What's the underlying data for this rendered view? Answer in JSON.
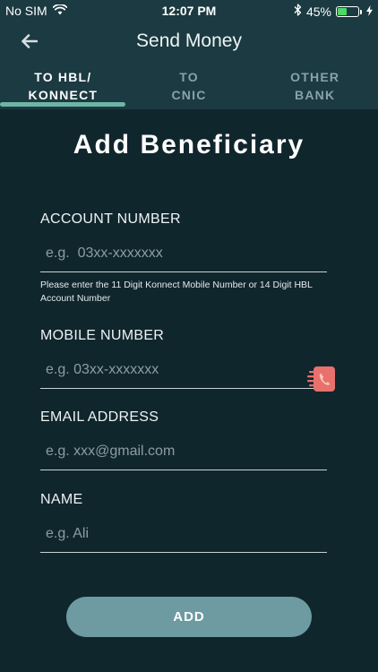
{
  "status_bar": {
    "carrier": "No SIM",
    "time": "12:07 PM",
    "battery": "45%",
    "battery_level": 0.45
  },
  "header": {
    "title": "Send Money"
  },
  "tabs": [
    {
      "label": "TO HBL/\nKONNECT",
      "active": true
    },
    {
      "label": "TO\nCNIC",
      "active": false
    },
    {
      "label": "OTHER\nBANK",
      "active": false
    }
  ],
  "page_title": "Add Beneficiary",
  "form": {
    "account_number": {
      "label": "ACCOUNT NUMBER",
      "placeholder": "e.g.  03xx-xxxxxxx",
      "value": "",
      "hint": "Please enter the 11 Digit Konnect Mobile Number or 14 Digit HBL Account Number"
    },
    "mobile_number": {
      "label": "MOBILE NUMBER",
      "placeholder": "e.g. 03xx-xxxxxxx",
      "value": ""
    },
    "email_address": {
      "label": "EMAIL ADDRESS",
      "placeholder": "e.g. xxx@gmail.com",
      "value": ""
    },
    "name": {
      "label": "NAME",
      "placeholder": "e.g. Ali",
      "value": ""
    }
  },
  "add_button_label": "ADD",
  "icons": {
    "wifi": "wifi-icon",
    "bluetooth": "bluetooth-icon",
    "battery": "battery-icon",
    "charging": "charging-icon",
    "back": "back-arrow-icon",
    "contacts": "contact-book-icon"
  },
  "colors": {
    "background": "#10262d",
    "header": "#1b3a41",
    "tab_indicator": "#6fb5a6",
    "button": "#6e9aa1",
    "contact_icon": "#e8706d",
    "battery_fill": "#4cd964"
  }
}
